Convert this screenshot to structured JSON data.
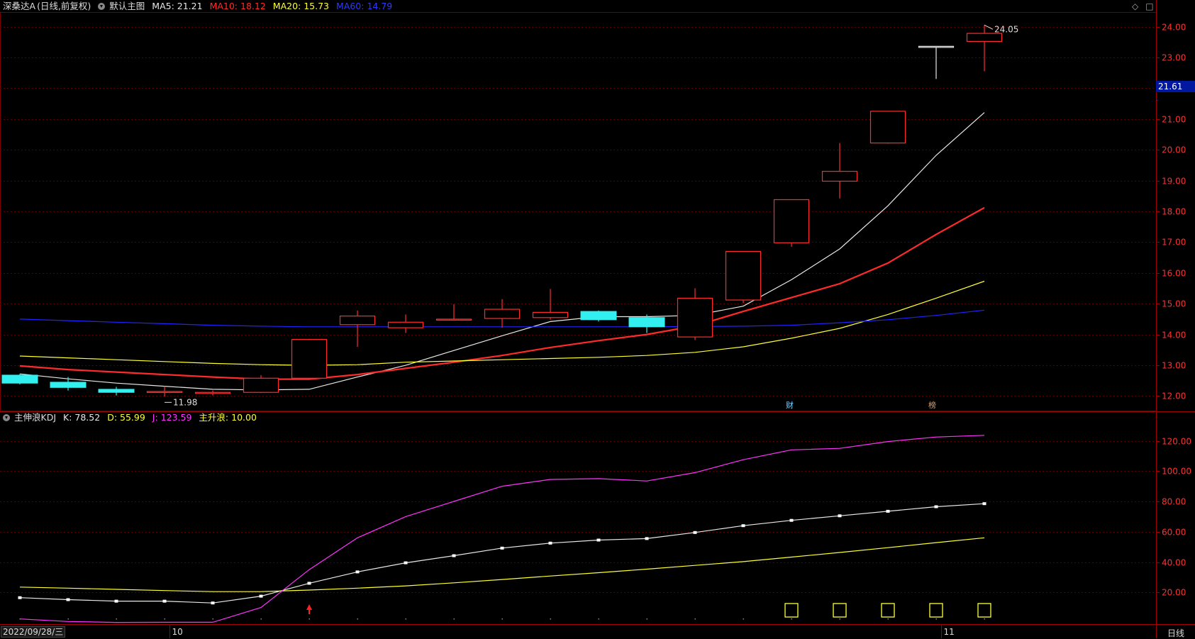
{
  "stock": {
    "name": "深桑达A",
    "mode": "(日线,前复权)",
    "template": "默认主图"
  },
  "ma_legend": [
    {
      "label": "MA5:",
      "value": "21.21",
      "color": "#e8e8e8"
    },
    {
      "label": "MA10:",
      "value": "18.12",
      "color": "#ff2b2b"
    },
    {
      "label": "MA20:",
      "value": "15.73",
      "color": "#ffff33"
    },
    {
      "label": "MA60:",
      "value": "14.79",
      "color": "#2222ff"
    }
  ],
  "kdj_legend": {
    "name": "主伸浪KDJ",
    "items": [
      {
        "label": "K:",
        "value": "78.52",
        "color": "#e8e8e8"
      },
      {
        "label": "D:",
        "value": "55.99",
        "color": "#ffff33"
      },
      {
        "label": "J:",
        "value": "123.59",
        "color": "#ff33ff"
      },
      {
        "label": "主升浪:",
        "value": "10.00",
        "color": "#ffff33"
      }
    ]
  },
  "icons": [
    "diamond-icon",
    "window-icon"
  ],
  "current_price_badge": "21.61",
  "high_label": "24.05",
  "low_label": "11.98",
  "markers": {
    "finance": "财",
    "ranking": "榜"
  },
  "x_axis": {
    "date_box": "2022/09/28/三",
    "month_labels": [
      "10",
      "11"
    ],
    "period": "日线"
  },
  "chart_data": [
    {
      "type": "candlestick",
      "title": "深桑达A (日线,前复权)",
      "y_ticks": [
        "24.00",
        "23.00",
        "22.00",
        "21.00",
        "20.00",
        "19.00",
        "18.00",
        "17.00",
        "16.00",
        "15.00",
        "14.00",
        "13.00",
        "12.00"
      ],
      "ylim": [
        11.55,
        24.45
      ],
      "candles": [
        {
          "o": 12.68,
          "h": 12.72,
          "l": 12.38,
          "c": 12.42
        },
        {
          "o": 12.45,
          "h": 12.62,
          "l": 12.18,
          "c": 12.28
        },
        {
          "o": 12.22,
          "h": 12.3,
          "l": 12.02,
          "c": 12.12
        },
        {
          "o": 12.15,
          "h": 12.32,
          "l": 11.98,
          "c": 12.15
        },
        {
          "o": 12.12,
          "h": 12.18,
          "l": 12.02,
          "c": 12.12
        },
        {
          "o": 12.12,
          "h": 12.68,
          "l": 12.1,
          "c": 12.58
        },
        {
          "o": 12.58,
          "h": 13.86,
          "l": 12.55,
          "c": 13.84
        },
        {
          "o": 14.32,
          "h": 14.78,
          "l": 13.6,
          "c": 14.6
        },
        {
          "o": 14.22,
          "h": 14.65,
          "l": 14.05,
          "c": 14.4
        },
        {
          "o": 14.5,
          "h": 14.98,
          "l": 14.45,
          "c": 14.5
        },
        {
          "o": 14.52,
          "h": 15.15,
          "l": 14.22,
          "c": 14.82
        },
        {
          "o": 14.55,
          "h": 15.48,
          "l": 14.48,
          "c": 14.72
        },
        {
          "o": 14.75,
          "h": 14.78,
          "l": 14.42,
          "c": 14.48
        },
        {
          "o": 14.55,
          "h": 14.65,
          "l": 14.05,
          "c": 14.25
        },
        {
          "o": 13.92,
          "h": 15.5,
          "l": 13.82,
          "c": 15.18
        },
        {
          "o": 15.12,
          "h": 16.7,
          "l": 15.02,
          "c": 16.7
        },
        {
          "o": 16.98,
          "h": 18.38,
          "l": 16.85,
          "c": 18.38
        },
        {
          "o": 18.98,
          "h": 20.22,
          "l": 18.42,
          "c": 19.3
        },
        {
          "o": 20.22,
          "h": 21.25,
          "l": 20.2,
          "c": 21.25
        },
        {
          "o": 23.36,
          "h": 23.36,
          "l": 22.3,
          "c": 23.36
        },
        {
          "o": 23.52,
          "h": 24.05,
          "l": 22.55,
          "c": 23.78
        }
      ],
      "series": [
        {
          "name": "MA5",
          "color": "#e8e8e8",
          "values": [
            12.72,
            12.56,
            12.42,
            12.32,
            12.22,
            12.2,
            12.22,
            12.62,
            13.0,
            13.48,
            13.96,
            14.42,
            14.58,
            14.58,
            14.62,
            14.92,
            15.78,
            16.78,
            18.18,
            19.82,
            21.21
          ]
        },
        {
          "name": "MA10",
          "color": "#ff2b2b",
          "values": [
            12.98,
            12.86,
            12.78,
            12.7,
            12.62,
            12.55,
            12.55,
            12.7,
            12.9,
            13.1,
            13.32,
            13.58,
            13.8,
            14.0,
            14.28,
            14.75,
            15.2,
            15.65,
            16.32,
            17.25,
            18.12
          ]
        },
        {
          "name": "MA20",
          "color": "#ffff33",
          "values": [
            13.3,
            13.24,
            13.18,
            13.12,
            13.06,
            13.02,
            13.0,
            13.02,
            13.1,
            13.14,
            13.18,
            13.22,
            13.26,
            13.32,
            13.42,
            13.6,
            13.88,
            14.2,
            14.65,
            15.18,
            15.73
          ]
        },
        {
          "name": "MA60",
          "color": "#2222ff",
          "values": [
            14.5,
            14.45,
            14.4,
            14.35,
            14.3,
            14.27,
            14.25,
            14.25,
            14.25,
            14.25,
            14.25,
            14.25,
            14.25,
            14.25,
            14.26,
            14.27,
            14.3,
            14.38,
            14.48,
            14.62,
            14.79
          ]
        }
      ]
    },
    {
      "type": "line",
      "title": "主伸浪KDJ",
      "y_ticks": [
        "120.00",
        "100.00",
        "80.00",
        "60.00",
        "40.00",
        "20.00"
      ],
      "ylim": [
        0,
        131
      ],
      "series": [
        {
          "name": "K",
          "color": "#e8e8e8",
          "values": [
            16.5,
            15.2,
            14.2,
            14.2,
            13.0,
            17.5,
            26.0,
            33.5,
            39.5,
            44.2,
            49.2,
            52.5,
            54.5,
            55.5,
            59.5,
            64.0,
            67.5,
            70.5,
            73.5,
            76.5,
            78.52
          ]
        },
        {
          "name": "D",
          "color": "#ffff33",
          "values": [
            23.5,
            22.8,
            22.0,
            21.2,
            20.5,
            20.5,
            21.5,
            22.8,
            24.3,
            26.3,
            28.5,
            30.8,
            33.0,
            35.3,
            37.8,
            40.3,
            43.3,
            46.3,
            49.5,
            52.8,
            55.99
          ]
        },
        {
          "name": "J",
          "color": "#ff33ff",
          "values": [
            2.5,
            0.8,
            0.2,
            0.3,
            0.3,
            10.0,
            35.0,
            56.0,
            70.0,
            80.0,
            90.0,
            94.5,
            95.0,
            93.5,
            99.0,
            107.5,
            114.0,
            115.0,
            119.5,
            122.5,
            123.59
          ]
        }
      ],
      "signal_boxes": [
        16,
        17,
        18,
        19,
        20
      ],
      "buy_arrow": 6
    }
  ]
}
